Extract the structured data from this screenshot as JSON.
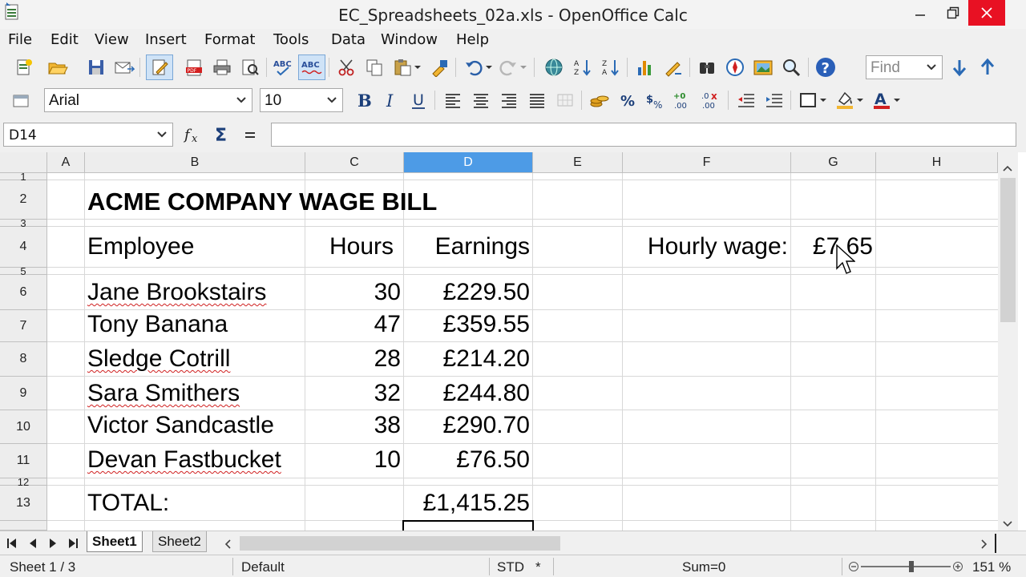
{
  "window": {
    "title": "EC_Spreadsheets_02a.xls - OpenOffice Calc",
    "accent_close": "#e81123"
  },
  "menu": [
    {
      "label": "File"
    },
    {
      "label": "Edit"
    },
    {
      "label": "View"
    },
    {
      "label": "Insert"
    },
    {
      "label": "Format"
    },
    {
      "label": "Tools"
    },
    {
      "label": "Data"
    },
    {
      "label": "Window"
    },
    {
      "label": "Help"
    }
  ],
  "toolbar": {
    "find_placeholder": "Find",
    "font_name": "Arial",
    "font_size": "10"
  },
  "formula": {
    "cell_ref": "D14",
    "function_icon": "fx",
    "sum_icon": "Σ",
    "equals": "=",
    "content": ""
  },
  "grid": {
    "columns": [
      "A",
      "B",
      "C",
      "D",
      "E",
      "F",
      "G",
      "H"
    ],
    "selected_column": "D",
    "rows": [
      "1",
      "2",
      "3",
      "4",
      "5",
      "6",
      "7",
      "8",
      "9",
      "10",
      "11",
      "12",
      "13"
    ],
    "title": "ACME COMPANY WAGE BILL",
    "headers": {
      "employee": "Employee",
      "hours": "Hours",
      "earnings": "Earnings"
    },
    "hourly_label": "Hourly wage:",
    "hourly_value": "£7.65",
    "employees": [
      {
        "name": "Jane Brookstairs",
        "hours": "30",
        "earnings": "£229.50"
      },
      {
        "name": "Tony Banana",
        "hours": "47",
        "earnings": "£359.55"
      },
      {
        "name": "Sledge Cotrill",
        "hours": "28",
        "earnings": "£214.20"
      },
      {
        "name": "Sara Smithers",
        "hours": "32",
        "earnings": "£244.80"
      },
      {
        "name": "Victor Sandcastle",
        "hours": "38",
        "earnings": "£290.70"
      },
      {
        "name": "Devan Fastbucket",
        "hours": "10",
        "earnings": "£76.50"
      }
    ],
    "total_label": "TOTAL:",
    "total_value": "£1,415.25"
  },
  "sheets": {
    "tabs": [
      "Sheet1",
      "Sheet2"
    ],
    "active": "Sheet1"
  },
  "status": {
    "sheet_position": "Sheet 1 / 3",
    "page_style": "Default",
    "selection_mode": "STD",
    "modified": "*",
    "sum": "Sum=0",
    "zoom": "151 %"
  }
}
